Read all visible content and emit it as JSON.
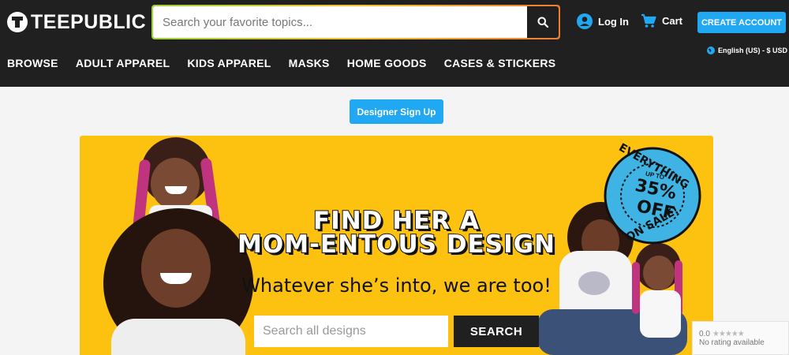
{
  "header": {
    "logo_text": "TEEPUBLIC",
    "search_placeholder": "Search your favorite topics...",
    "login_label": "Log In",
    "cart_label": "Cart",
    "create_account_label": "CREATE ACCOUNT",
    "locale_label": "English (US) - $ USD"
  },
  "nav": {
    "items": [
      {
        "label": "BROWSE"
      },
      {
        "label": "ADULT APPAREL"
      },
      {
        "label": "KIDS APPAREL"
      },
      {
        "label": "MASKS"
      },
      {
        "label": "HOME GOODS"
      },
      {
        "label": "CASES & STICKERS"
      }
    ]
  },
  "designer_signup_label": "Designer Sign Up",
  "hero": {
    "title_line1": "FIND HER A",
    "title_line2": "MOM-ENTOUS DESIGN",
    "subtitle": "Whatever she’s into, we are too!",
    "search_placeholder": "Search all designs",
    "search_button": "SEARCH",
    "badge": {
      "top_text": "EVERYTHING",
      "up_to": "UP TO",
      "percent": "35%",
      "off": "OFF",
      "bottom_text": "ON SALE!"
    }
  },
  "rating": {
    "score": "0.0",
    "stars": "★★★★★",
    "text": "No rating available"
  },
  "colors": {
    "header_bg": "#202020",
    "accent_blue": "#20a9f2",
    "hero_yellow": "#fdc20f",
    "badge_blue": "#3fb3e3"
  }
}
